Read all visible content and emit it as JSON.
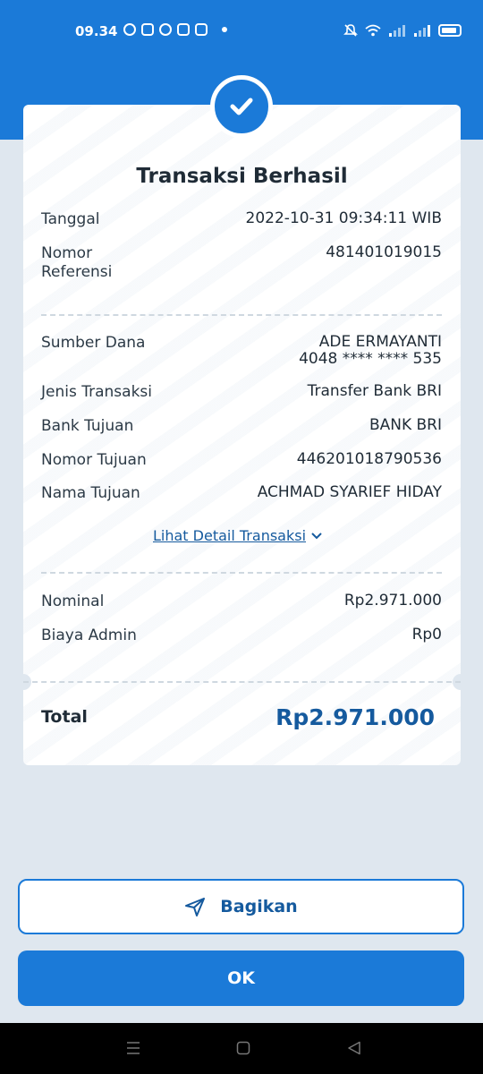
{
  "status_bar": {
    "time": "09.34"
  },
  "receipt": {
    "title": "Transaksi Berhasil",
    "rows_top": [
      {
        "label": "Tanggal",
        "value": "2022-10-31 09:34:11 WIB"
      },
      {
        "label": "Nomor\nReferensi",
        "value": "481401019015"
      }
    ],
    "source": {
      "label": "Sumber Dana",
      "name": "ADE ERMAYANTI",
      "account": "4048 **** **** 535"
    },
    "rows_mid": [
      {
        "label": "Jenis Transaksi",
        "value": "Transfer Bank BRI"
      },
      {
        "label": "Bank Tujuan",
        "value": "BANK BRI"
      },
      {
        "label": "Nomor Tujuan",
        "value": "446201018790536"
      },
      {
        "label": "Nama Tujuan",
        "value": "ACHMAD SYARIEF HIDAY"
      }
    ],
    "detail_link": "Lihat Detail Transaksi",
    "rows_fee": [
      {
        "label": "Nominal",
        "value": "Rp2.971.000"
      },
      {
        "label": "Biaya Admin",
        "value": "Rp0"
      }
    ],
    "total_label": "Total",
    "total_value": "Rp2.971.000"
  },
  "buttons": {
    "share": "Bagikan",
    "ok": "OK"
  },
  "colors": {
    "primary": "#1b7ad8",
    "link": "#155a9e",
    "background": "#dfe7ef"
  }
}
